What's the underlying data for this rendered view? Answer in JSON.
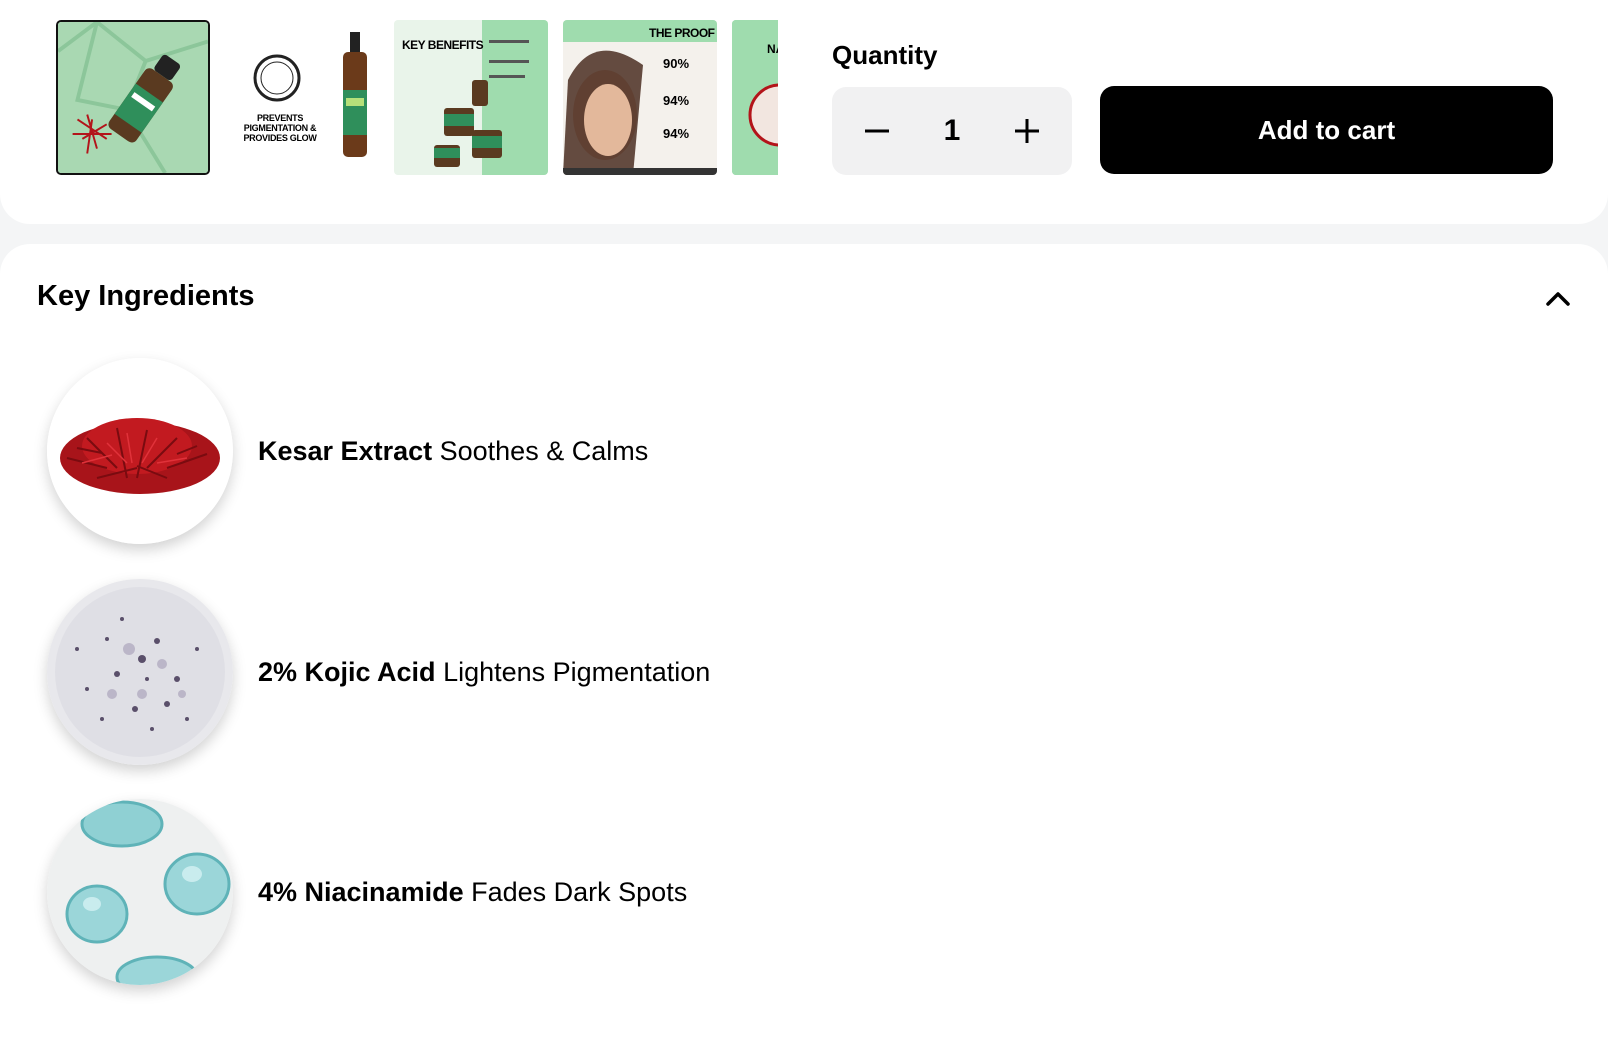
{
  "gallery": {
    "thumbnails": [
      {
        "alt": "serum-bottle-with-saffron",
        "active": true,
        "text": ""
      },
      {
        "alt": "lightweight-badge-bottle",
        "active": false,
        "text": "PREVENTS PIGMENTATION & PROVIDES GLOW"
      },
      {
        "alt": "key-benefits",
        "active": false,
        "text": "KEY BENEFITS"
      },
      {
        "alt": "the-proof",
        "active": false,
        "text": "THE PROOF"
      },
      {
        "alt": "partial-next",
        "active": false,
        "text": "NA"
      }
    ]
  },
  "purchase": {
    "quantity_label": "Quantity",
    "quantity_value": "1",
    "add_to_cart_label": "Add to cart"
  },
  "ingredients": {
    "title": "Key Ingredients",
    "items": [
      {
        "name": "Kesar Extract",
        "benefit": "Soothes & Calms",
        "image": "saffron"
      },
      {
        "name": "2% Kojic Acid",
        "benefit": "Lightens Pigmentation",
        "image": "kojic-powder"
      },
      {
        "name": "4% Niacinamide",
        "benefit": "Fades Dark Spots",
        "image": "gel-drops"
      }
    ]
  },
  "colors": {
    "brand_green": "#2f8f5b",
    "light_green": "#9fdcae",
    "button_black": "#000000",
    "saffron_red": "#b3141a"
  }
}
